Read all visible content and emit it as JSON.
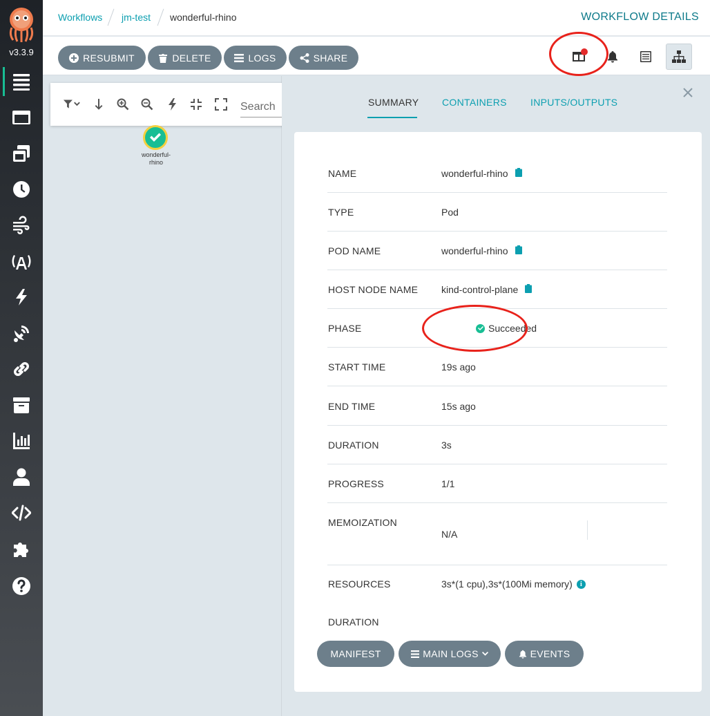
{
  "app": {
    "version": "v3.3.9"
  },
  "breadcrumb": {
    "workflows": "Workflows",
    "namespace": "jm-test",
    "current": "wonderful-rhino"
  },
  "header": {
    "title": "WORKFLOW DETAILS"
  },
  "toolbar": {
    "resubmit": "RESUBMIT",
    "delete": "DELETE",
    "logs": "LOGS",
    "share": "SHARE"
  },
  "graph": {
    "search_placeholder": "Search",
    "node": {
      "label_line1": "wonderful-",
      "label_line2": "rhino",
      "status": "succeeded"
    }
  },
  "tabs": {
    "summary": "SUMMARY",
    "containers": "CONTAINERS",
    "inputs_outputs": "INPUTS/OUTPUTS"
  },
  "details": [
    {
      "key": "NAME",
      "value": "wonderful-rhino"
    },
    {
      "key": "TYPE",
      "value": "Pod"
    },
    {
      "key": "POD NAME",
      "value": "wonderful-rhino"
    },
    {
      "key": "HOST NODE NAME",
      "value": "kind-control-plane"
    },
    {
      "key": "PHASE",
      "value": "Succeeded"
    },
    {
      "key": "START TIME",
      "value": "19s ago"
    },
    {
      "key": "END TIME",
      "value": "15s ago"
    },
    {
      "key": "DURATION",
      "value": "3s"
    },
    {
      "key": "PROGRESS",
      "value": "1/1"
    },
    {
      "key": "MEMOIZATION",
      "value": "N/A"
    },
    {
      "key": "RESOURCES",
      "value": "3s*(1 cpu),3s*(100Mi memory)"
    },
    {
      "key": "DURATION",
      "value": ""
    }
  ],
  "actions": {
    "manifest": "MANIFEST",
    "main_logs": "MAIN LOGS",
    "events": "EVENTS"
  },
  "colors": {
    "accent": "#0c9fb0",
    "success": "#18be94",
    "sidebar": "#1e2227",
    "button": "#6d7f8b",
    "annotation": "#e8221b"
  }
}
